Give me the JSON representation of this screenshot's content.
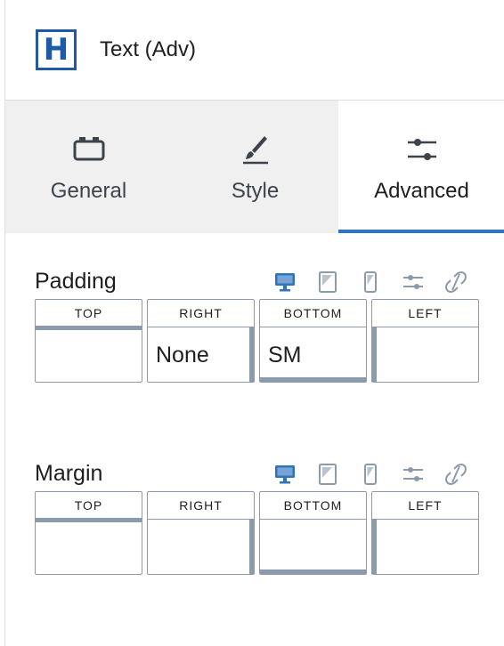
{
  "block": {
    "icon_letter": "H",
    "title": "Text (Adv)"
  },
  "tabs": [
    {
      "label": "General",
      "icon": "toolbox-icon",
      "active": false
    },
    {
      "label": "Style",
      "icon": "brush-icon",
      "active": false
    },
    {
      "label": "Advanced",
      "icon": "sliders-icon",
      "active": true
    }
  ],
  "device_controls": [
    "desktop-icon",
    "tablet-icon",
    "mobile-icon",
    "settings-sliders-icon",
    "unlink-icon"
  ],
  "padding": {
    "title": "Padding",
    "boxes": [
      {
        "label": "TOP",
        "value": ""
      },
      {
        "label": "RIGHT",
        "value": "None"
      },
      {
        "label": "BOTTOM",
        "value": "SM"
      },
      {
        "label": "LEFT",
        "value": ""
      }
    ]
  },
  "margin": {
    "title": "Margin",
    "boxes": [
      {
        "label": "TOP",
        "value": ""
      },
      {
        "label": "RIGHT",
        "value": ""
      },
      {
        "label": "BOTTOM",
        "value": ""
      },
      {
        "label": "LEFT",
        "value": ""
      }
    ]
  },
  "colors": {
    "accent": "#2f74bf",
    "border": "#8c9bab",
    "icon_muted": "#8c9bab"
  }
}
